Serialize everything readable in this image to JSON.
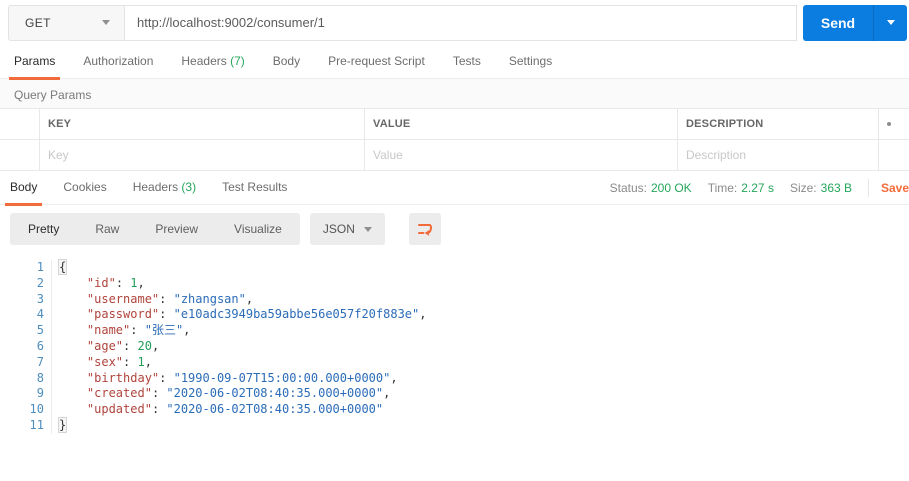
{
  "request": {
    "method": "GET",
    "url": "http://localhost:9002/consumer/1",
    "send_label": "Send",
    "tabs": [
      {
        "label": "Params",
        "active": true
      },
      {
        "label": "Authorization"
      },
      {
        "label": "Headers",
        "count": "(7)"
      },
      {
        "label": "Body"
      },
      {
        "label": "Pre-request Script"
      },
      {
        "label": "Tests"
      },
      {
        "label": "Settings"
      }
    ],
    "query_params": {
      "section_label": "Query Params",
      "columns": [
        "KEY",
        "VALUE",
        "DESCRIPTION"
      ],
      "row_placeholders": [
        "Key",
        "Value",
        "Description"
      ],
      "menu_icon": "more-options-dot-icon"
    }
  },
  "response": {
    "tabs": [
      {
        "label": "Body",
        "active": true
      },
      {
        "label": "Cookies"
      },
      {
        "label": "Headers",
        "count": "(3)"
      },
      {
        "label": "Test Results"
      }
    ],
    "meta": {
      "items": [
        {
          "label": "Status:",
          "value": "200 OK"
        },
        {
          "label": "Time:",
          "value": "2.27 s"
        },
        {
          "label": "Size:",
          "value": "363 B"
        }
      ],
      "save_label": "Save"
    },
    "view_tabs": [
      {
        "label": "Pretty",
        "active": true
      },
      {
        "label": "Raw"
      },
      {
        "label": "Preview"
      },
      {
        "label": "Visualize"
      }
    ],
    "language": "JSON",
    "wrap_icon": "wrap-text-icon",
    "code": {
      "lines": [
        [
          [
            "{",
            "b"
          ]
        ],
        [
          [
            "    ",
            "p"
          ],
          [
            "\"id\"",
            "k"
          ],
          [
            ": ",
            "p"
          ],
          [
            "1",
            "n"
          ],
          [
            ",",
            "p"
          ]
        ],
        [
          [
            "    ",
            "p"
          ],
          [
            "\"username\"",
            "k"
          ],
          [
            ": ",
            "p"
          ],
          [
            "\"zhangsan\"",
            "s"
          ],
          [
            ",",
            "p"
          ]
        ],
        [
          [
            "    ",
            "p"
          ],
          [
            "\"password\"",
            "k"
          ],
          [
            ": ",
            "p"
          ],
          [
            "\"e10adc3949ba59abbe56e057f20f883e\"",
            "s"
          ],
          [
            ",",
            "p"
          ]
        ],
        [
          [
            "    ",
            "p"
          ],
          [
            "\"name\"",
            "k"
          ],
          [
            ": ",
            "p"
          ],
          [
            "\"张三\"",
            "s"
          ],
          [
            ",",
            "p"
          ]
        ],
        [
          [
            "    ",
            "p"
          ],
          [
            "\"age\"",
            "k"
          ],
          [
            ": ",
            "p"
          ],
          [
            "20",
            "n"
          ],
          [
            ",",
            "p"
          ]
        ],
        [
          [
            "    ",
            "p"
          ],
          [
            "\"sex\"",
            "k"
          ],
          [
            ": ",
            "p"
          ],
          [
            "1",
            "n"
          ],
          [
            ",",
            "p"
          ]
        ],
        [
          [
            "    ",
            "p"
          ],
          [
            "\"birthday\"",
            "k"
          ],
          [
            ": ",
            "p"
          ],
          [
            "\"1990-09-07T15:00:00.000+0000\"",
            "s"
          ],
          [
            ",",
            "p"
          ]
        ],
        [
          [
            "    ",
            "p"
          ],
          [
            "\"created\"",
            "k"
          ],
          [
            ": ",
            "p"
          ],
          [
            "\"2020-06-02T08:40:35.000+0000\"",
            "s"
          ],
          [
            ",",
            "p"
          ]
        ],
        [
          [
            "    ",
            "p"
          ],
          [
            "\"updated\"",
            "k"
          ],
          [
            ": ",
            "p"
          ],
          [
            "\"2020-06-02T08:40:35.000+0000\"",
            "s"
          ]
        ],
        [
          [
            "}",
            "b"
          ]
        ]
      ]
    }
  },
  "colors": {
    "accent_orange": "#f26b3a",
    "send_blue": "#0b7ce0",
    "success_green": "#26a65b",
    "json_key": "#b0443c",
    "json_string": "#2b6cb8",
    "json_number": "#249d58",
    "line_number_blue": "#4d8ebe"
  }
}
